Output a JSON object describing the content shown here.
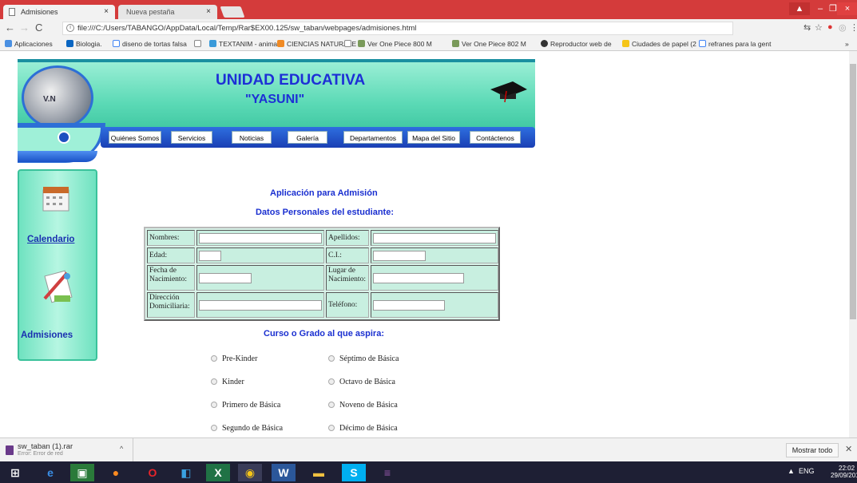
{
  "browser": {
    "tabs": [
      {
        "label": "Admisiones",
        "active": true
      },
      {
        "label": "Nueva pestaña",
        "active": false
      }
    ],
    "url": "file:///C:/Users/TABANGO/AppData/Local/Temp/Rar$EX00.125/sw_taban/webpages/admisiones.html",
    "bookmarks": [
      "Aplicaciones",
      "Biologia.",
      "diseno de tortas falsa",
      "",
      "TEXTANIM - animate",
      "CIENCIAS NATURALE",
      "",
      "Ver One Piece 800 M",
      "Ver One Piece 802 M",
      "Reproductor web de",
      "Ciudades de papel (2",
      "refranes para la gent"
    ],
    "bookmarks_overflow": "»"
  },
  "site": {
    "title_line1": "UNIDAD EDUCATIVA",
    "title_line2": "\"YASUNI\"",
    "logo_text": "V.N",
    "nav": [
      "Quiénes Somos",
      "Servicios",
      "Noticias",
      "Galería",
      "Departamentos",
      "Mapa del Sitio",
      "Contáctenos"
    ],
    "sidebar": {
      "calendar_label": "Calendario",
      "admissions_label": "Admisiones"
    }
  },
  "form": {
    "heading": "Aplicación para Admisión",
    "subheading": "Datos Personales del estudiante:",
    "fields": {
      "nombres": "Nombres:",
      "apellidos": "Apellidos:",
      "edad": "Edad:",
      "ci": "C.I.:",
      "fecha1": "Fecha de",
      "fecha2": "Nacimiento:",
      "lugar1": "Lugar de",
      "lugar2": "Nacimiento:",
      "direccion1": "Dirección",
      "direccion2": "Domiciliaria:",
      "telefono": "Teléfono:"
    },
    "grade_heading": "Curso o Grado al que aspira:",
    "grades_left": [
      "Pre-Kinder",
      "Kinder",
      "Primero de Básica",
      "Segundo de Básica"
    ],
    "grades_right": [
      "Séptimo de Básica",
      "Octavo de Básica",
      "Noveno de Básica",
      "Décimo de Básica"
    ]
  },
  "downloads": {
    "file_name": "sw_taban (1).rar",
    "status": "Error: Error de red",
    "show_all": "Mostrar todo"
  },
  "taskbar": {
    "lang": "ENG",
    "time": "22:02",
    "date": "29/09/2016"
  },
  "colors": {
    "tabstrip": "#d43b3b",
    "banner": "#5ad9b5",
    "nav": "#1a3fb4",
    "heading": "#1a2fd0"
  }
}
